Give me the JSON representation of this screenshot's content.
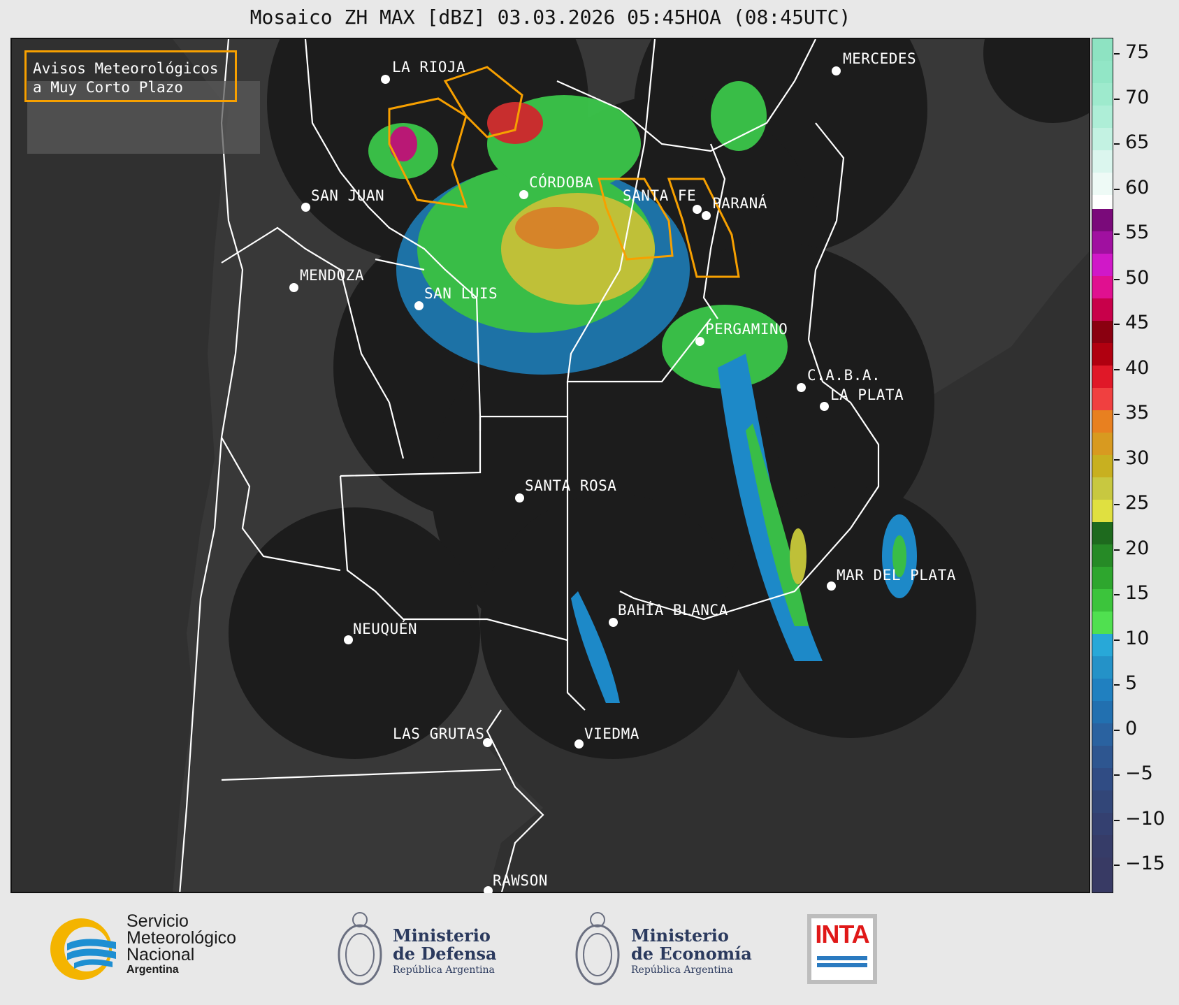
{
  "title": "Mosaico ZH MAX [dBZ] 03.03.2026 05:45HOA (08:45UTC)",
  "legend": {
    "line1": "Avisos Meteorológicos",
    "line2": "a Muy Corto Plazo",
    "color": "#f7a000"
  },
  "cities": [
    {
      "name": "LA RIOJA"
    },
    {
      "name": "MERCEDES"
    },
    {
      "name": "CÓRDOBA"
    },
    {
      "name": "SAN JUAN"
    },
    {
      "name": "SANTA FE"
    },
    {
      "name": "PARANÁ"
    },
    {
      "name": "MENDOZA"
    },
    {
      "name": "SAN LUIS"
    },
    {
      "name": "PERGAMINO"
    },
    {
      "name": "C.A.B.A."
    },
    {
      "name": "LA PLATA"
    },
    {
      "name": "SANTA ROSA"
    },
    {
      "name": "MAR DEL PLATA"
    },
    {
      "name": "BAHÍA BLANCA"
    },
    {
      "name": "NEUQUÉN"
    },
    {
      "name": "LAS GRUTAS"
    },
    {
      "name": "VIEDMA"
    },
    {
      "name": "RAWSON"
    }
  ],
  "colorbar": {
    "ticks": [
      "75",
      "70",
      "65",
      "60",
      "55",
      "50",
      "45",
      "40",
      "35",
      "30",
      "25",
      "20",
      "15",
      "10",
      "5",
      "0",
      "−5",
      "−10",
      "−15"
    ]
  },
  "footer": {
    "smn_line1": "Servicio",
    "smn_line2": "Meteorológico",
    "smn_line3": "Nacional",
    "smn_line4": "Argentina",
    "defensa_line1": "Ministerio",
    "defensa_line2": "de Defensa",
    "defensa_line3": "República Argentina",
    "economia_line1": "Ministerio",
    "economia_line2": "de Economía",
    "economia_line3": "República Argentina",
    "inta": "INTA"
  }
}
